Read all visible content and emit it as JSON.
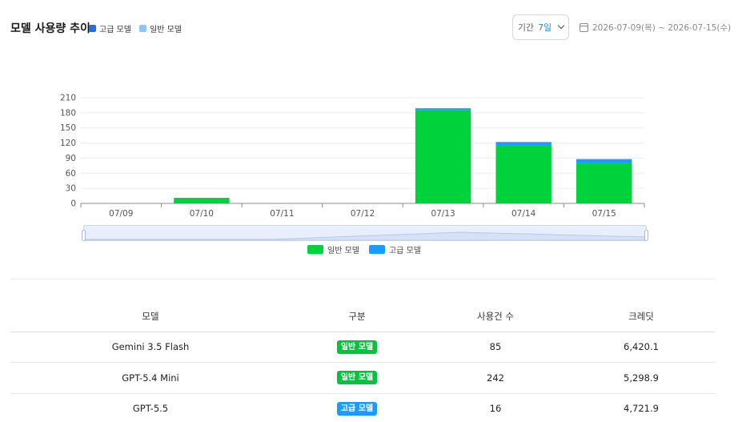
{
  "header": {
    "title": "모델 사용량 추이",
    "legend": [
      {
        "label": "고급 모델",
        "color": "#1f6fe8"
      },
      {
        "label": "일반 모델",
        "color": "#8ec3ff"
      }
    ],
    "period_label": "기간",
    "period_value": "7일",
    "date_range": "2026-07-09(목) ~ 2026-07-15(수)"
  },
  "chart_data": {
    "type": "bar",
    "stacked": true,
    "categories": [
      "07/09",
      "07/10",
      "07/11",
      "07/12",
      "07/13",
      "07/14",
      "07/15"
    ],
    "series": [
      {
        "name": "일반 모델",
        "color": "#00d23c",
        "values": [
          0,
          11,
          0,
          0,
          185,
          116,
          81
        ]
      },
      {
        "name": "고급 모델",
        "color": "#1a9bff",
        "values": [
          0,
          0,
          0,
          0,
          4,
          6,
          7
        ]
      }
    ],
    "ylim": [
      0,
      210
    ],
    "yticks": [
      0,
      30,
      60,
      90,
      120,
      150,
      180,
      210
    ],
    "grid": true,
    "legend_position": "bottom"
  },
  "table": {
    "columns": [
      "모델",
      "구분",
      "사용건 수",
      "크레딧"
    ],
    "rows": [
      {
        "model": "Gemini 3.5 Flash",
        "type": "일반 모델",
        "type_color": "#00c43a",
        "count": "85",
        "credit": "6,420.1"
      },
      {
        "model": "GPT-5.4 Mini",
        "type": "일반 모델",
        "type_color": "#00c43a",
        "count": "242",
        "credit": "5,298.9"
      },
      {
        "model": "GPT-5.5",
        "type": "고급 모델",
        "type_color": "#1a9bff",
        "count": "16",
        "credit": "4,721.9"
      }
    ]
  }
}
